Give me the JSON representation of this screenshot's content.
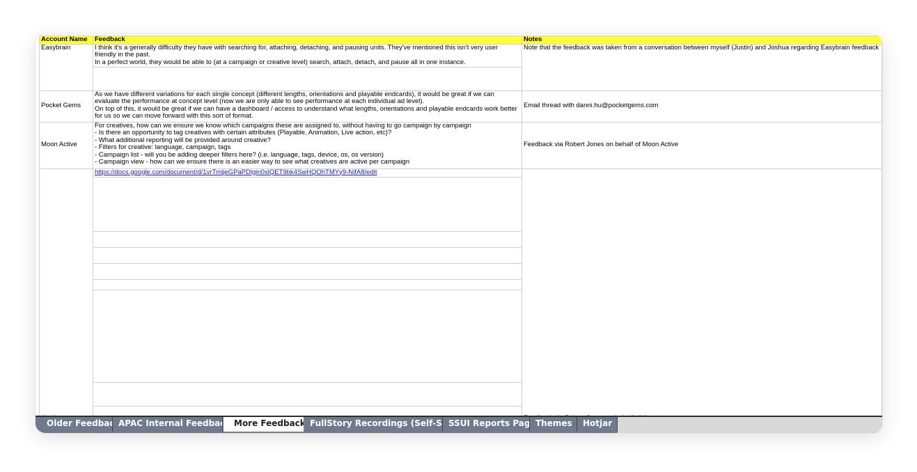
{
  "sheet": {
    "headers": [
      "Account Name",
      "Feedback",
      "Notes"
    ],
    "rows": [
      {
        "account": "Easybrain",
        "feedback": [
          "I think it's a generally difficulty they have with searching for, attaching, detaching, and pausing units. They've mentioned this isn't very user friendly in the past.",
          "In a perfect world, they would be able to (at a campaign or creative level) search, attach, detach, and pause all in one instance."
        ],
        "notes": "Note that the feedback was taken from a conversation between myself (Justin) and Joshua regarding Easybrain feedback"
      },
      {
        "account": "Pocket Gems",
        "feedback": [
          "As we have different variations for each single concept (different lengths, orientations and playable endcards), it would be great if we can evaluate the performance at concept level (now we are only able to see performance at each individual ad level).",
          "On top of this, it would be great if we can have a dashboard / access to understand what lengths, orientations and playable endcards work better for us so we can move forward with this sort of format."
        ],
        "notes": "Email thread with danni.hu@pocketgems.com"
      },
      {
        "account": "Moon Active",
        "feedback": [
          "For creatives, how can we ensure we know which campaigns these are assigned to, without having to go campaign by campaign",
          "- Is there an opportunity to tag creatives with certain attributes (Playable, Animation, Live action, etc)?",
          "- What additional reporting will be provided around creative?",
          "- Filters for creative: language, campaign, tags",
          "- Campaign list - will you be adding deeper filters here? (i.e. language, tags, device, os, os version)",
          "- Campaign view - how can we ensure there is an easier way to see what creatives are active per campaign"
        ],
        "notes": "Feedback via Robert Jones on behalf of Moon Active"
      },
      {
        "account": "Kwalee",
        "feedback_link": "https://docs.google.com/document/d/1vrTmljeGPaPDlgin0slQET9bk4SwHQOhTMYy9-NifA8/edit",
        "notes": "Feedback via Robert Jones on behalf of Kwalee"
      }
    ]
  },
  "tabs": [
    {
      "label": "Older Feedback",
      "active": false
    },
    {
      "label": "APAC Internal Feedback",
      "active": false
    },
    {
      "label": "More Feedback",
      "active": true
    },
    {
      "label": "FullStory Recordings (Self-Serv",
      "active": false
    },
    {
      "label": "SSUI Reports Page",
      "active": false
    },
    {
      "label": "Themes",
      "active": false
    },
    {
      "label": "Hotjar",
      "active": false
    }
  ],
  "colors": {
    "header_fill": "#ffff33",
    "link": "#1a1ad0",
    "tab_fill": "#6f7a8c",
    "active_tab_fill": "#ffffff"
  }
}
